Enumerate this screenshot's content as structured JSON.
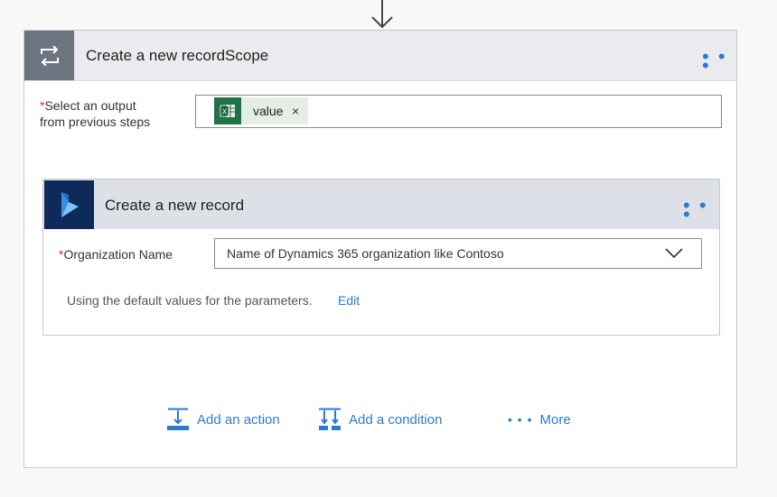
{
  "scope": {
    "title": "Create a new recordScope",
    "menu_icon": "ellipsis-icon",
    "icon": "loop-icon"
  },
  "select_output": {
    "required_mark": "*",
    "label_line1": "Select an output",
    "label_line2": "from previous steps",
    "token": {
      "icon": "excel-icon",
      "icon_letter": "X",
      "label": "value",
      "remove": "×"
    }
  },
  "record": {
    "title": "Create a new record",
    "icon": "dynamics-365-icon",
    "menu_icon": "ellipsis-icon",
    "org_required_mark": "*",
    "org_label": "Organization Name",
    "org_placeholder": "Name of Dynamics 365 organization like Contoso",
    "defaults_text": "Using the default values for the parameters.",
    "edit_link": "Edit"
  },
  "footer": {
    "add_action": "Add an action",
    "add_condition": "Add a condition",
    "more": "More",
    "more_dots": "• • •"
  },
  "colors": {
    "accent": "#2b7bd0",
    "scope_icon_bg": "#6b7480",
    "dynamics_bg": "#0e2a5b",
    "excel_green": "#217346",
    "required": "#d13438"
  }
}
